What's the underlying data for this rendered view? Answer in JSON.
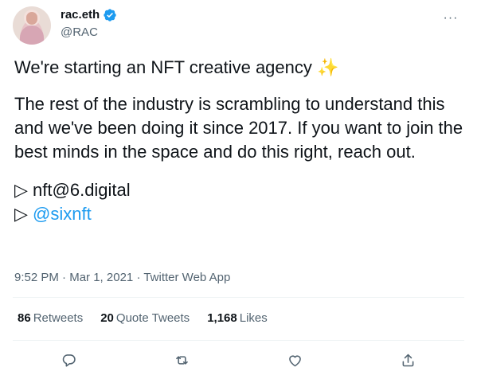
{
  "author": {
    "display_name": "rac.eth",
    "handle": "@RAC",
    "verified_icon": "verified-badge-icon"
  },
  "tweet": {
    "line1": "We're starting an NFT creative agency",
    "sparkle": "✨",
    "paragraph2": "The rest of the industry is scrambling to understand this and we've been doing it since 2017. If you want to join the best minds in the space and do this right, reach out.",
    "bullet_glyph": "▷",
    "email": "nft@6.digital",
    "mention": "@sixnft"
  },
  "meta": {
    "time": "9:52 PM",
    "date": "Mar 1, 2021",
    "source": "Twitter Web App",
    "separator": "·"
  },
  "stats": {
    "retweets_count": "86",
    "retweets_label": "Retweets",
    "quotes_count": "20",
    "quotes_label": "Quote Tweets",
    "likes_count": "1,168",
    "likes_label": "Likes"
  },
  "more_glyph": "···",
  "colors": {
    "link": "#1d9bf0",
    "muted": "#536471",
    "text": "#0f1419",
    "divider": "#eff3f4"
  }
}
